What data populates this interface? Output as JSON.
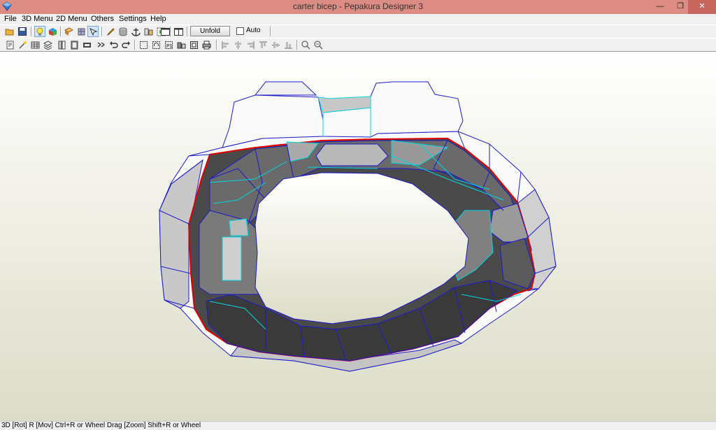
{
  "window": {
    "title": "carter bicep - Pepakura Designer 3",
    "minimize_glyph": "—",
    "restore_glyph": "❐",
    "close_glyph": "✕"
  },
  "menu": [
    "File",
    "3D Menu",
    "2D Menu",
    "Others",
    "Settings",
    "Help"
  ],
  "toolbar1": {
    "icons": [
      "open-icon",
      "save-icon",
      "light-icon",
      "color-icon",
      "paper-icon",
      "texture-icon",
      "select-icon",
      "pencil-icon",
      "cylinder-icon",
      "anchor-icon",
      "parts-icon",
      "chart-icon",
      "single-view-icon",
      "dual-view-icon"
    ],
    "unfold_label": "Unfold",
    "auto_label": "Auto",
    "auto_checked": false
  },
  "toolbar2": {
    "icons": [
      "print-icon",
      "wand-icon",
      "grid-icon",
      "layers-icon",
      "edge-icon",
      "book-icon",
      "flap-icon",
      "join-icon",
      "undo-icon",
      "redo-icon",
      "select-rect-icon",
      "rotate-part-icon",
      "move-part-icon",
      "join-part-icon",
      "hide-icon",
      "print-sheet-icon",
      "align-left-icon",
      "align-center-icon",
      "align-right-icon",
      "align-top-icon",
      "align-middle-icon",
      "align-bottom-icon",
      "zoom-icon",
      "zoom-fit-icon"
    ]
  },
  "status": {
    "text": "3D [Rot] R [Mov] Ctrl+R or Wheel Drag [Zoom] Shift+R or Wheel"
  },
  "colors": {
    "titlebar": "#dc8c82",
    "viewport_top": "#ffffff",
    "viewport_bottom": "#dcdcc7",
    "outline_red": "#e00000",
    "edge_blue": "#1a1acc",
    "edge_cyan": "#00d8e0"
  }
}
